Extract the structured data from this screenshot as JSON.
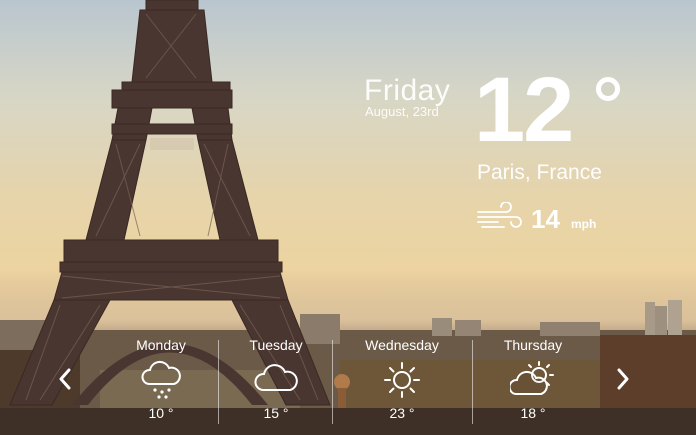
{
  "current": {
    "day": "Friday",
    "date": "August, 23rd",
    "temperature": "12",
    "location": "Paris, France",
    "wind_speed": "14",
    "wind_unit": "mph",
    "wind_icon": "wind-icon"
  },
  "forecast": [
    {
      "day": "Monday",
      "temp": "10 °",
      "icon": "rain-cloud-icon"
    },
    {
      "day": "Tuesday",
      "temp": "15 °",
      "icon": "cloud-icon"
    },
    {
      "day": "Wednesday",
      "temp": "23 °",
      "icon": "sun-icon"
    },
    {
      "day": "Thursday",
      "temp": "18 °",
      "icon": "partly-cloudy-icon"
    }
  ],
  "navigation": {
    "prev_icon": "chevron-left-icon",
    "next_icon": "chevron-right-icon"
  },
  "colors": {
    "text": "#ffffff",
    "tower": "#4a3631",
    "sky_top": "#b9c6cf",
    "sky_warm": "#ecd3a0"
  }
}
